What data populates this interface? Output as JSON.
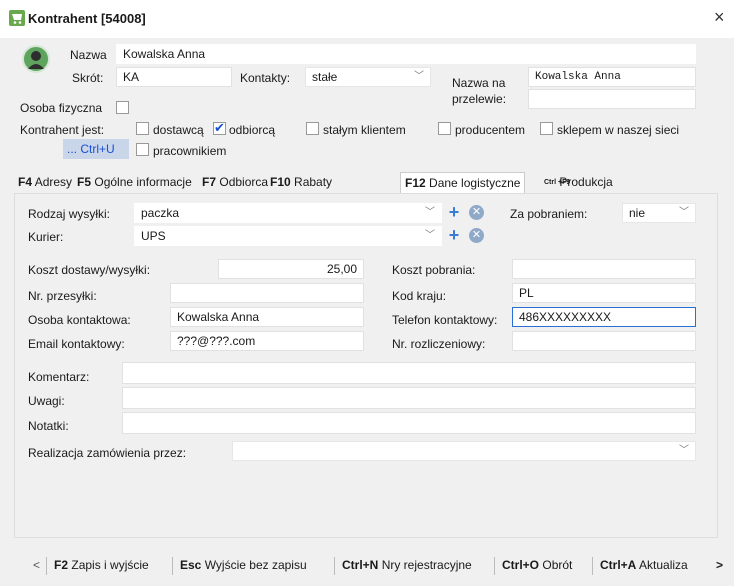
{
  "window": {
    "title": "Kontrahent [54008]",
    "close": "×"
  },
  "header": {
    "nazwa_label": "Nazwa",
    "nazwa_value": "Kowalska Anna",
    "skrot_label": "Skrót:",
    "skrot_value": "KA",
    "kontakty_label": "Kontakty:",
    "kontakty_value": "stałe",
    "nazwa_przelew_label1": "Nazwa na",
    "nazwa_przelew_label2": "przelewie:",
    "nazwa_przelew_value": "Kowalska Anna",
    "osoba_fizyczna": "Osoba fizyczna",
    "kontrahent_jest": "Kontrahent jest:",
    "ctrl_u": "... Ctrl+U",
    "types": {
      "dostawca": "dostawcą",
      "odbiorca": "odbiorcą",
      "stalym": "stałym klientem",
      "producentem": "producentem",
      "sklepem": "sklepem w naszej sieci",
      "pracownikiem": "pracownikiem"
    }
  },
  "tabs": [
    {
      "key": "F4",
      "label": "Adresy"
    },
    {
      "key": "F5",
      "label": "Ogólne informacje"
    },
    {
      "key": "F7",
      "label": "Odbiorca"
    },
    {
      "key": "F10",
      "label": "Rabaty"
    },
    {
      "key": "F12",
      "label": "Dane logistyczne"
    },
    {
      "key": "Ctrl +F9",
      "label": "Produkcja"
    }
  ],
  "form": {
    "rodzaj_label": "Rodzaj wysyłki:",
    "rodzaj_value": "paczka",
    "kurier_label": "Kurier:",
    "kurier_value": "UPS",
    "pobranie_label": "Za pobraniem:",
    "pobranie_value": "nie",
    "koszt_dostawy_label": "Koszt dostawy/wysyłki:",
    "koszt_dostawy_value": "25,00",
    "koszt_pobrania_label": "Koszt pobrania:",
    "koszt_pobrania_value": "",
    "nr_przesylki_label": "Nr. przesyłki:",
    "nr_przesylki_value": "",
    "kod_kraju_label": "Kod kraju:",
    "kod_kraju_value": "PL",
    "osoba_label": "Osoba kontaktowa:",
    "osoba_value": "Kowalska Anna",
    "telefon_label": "Telefon kontaktowy:",
    "telefon_value": "486XXXXXXXXX",
    "email_label": "Email kontaktowy:",
    "email_value": "???@???.com",
    "nr_rozl_label": "Nr. rozliczeniowy:",
    "nr_rozl_value": "",
    "komentarz_label": "Komentarz:",
    "uwagi_label": "Uwagi:",
    "notatki_label": "Notatki:",
    "realizacja_label": "Realizacja zamówienia przez:",
    "realizacja_value": ""
  },
  "bottom": {
    "prev": "<",
    "next": ">",
    "f2_key": "F2",
    "f2_label": "Zapis i wyjście",
    "esc_key": "Esc",
    "esc_label": "Wyjście bez zapisu",
    "ctrln_key": "Ctrl+N",
    "ctrln_label": "Nry rejestracyjne",
    "ctrlo_key": "Ctrl+O",
    "ctrlo_label": "Obrót",
    "ctrla_key": "Ctrl+A",
    "ctrla_label": "Aktualiza"
  },
  "colors": {
    "accent": "#1a4fd6",
    "icon_green": "#6aa84f",
    "focus": "#2a6fd6"
  }
}
